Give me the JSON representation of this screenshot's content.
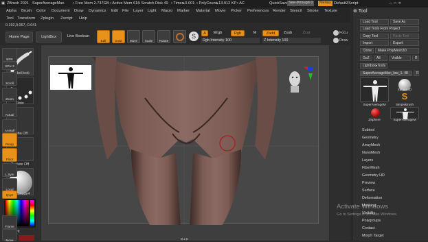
{
  "titlebar": {
    "app": "ZBrush 2021",
    "doc": "SuperAverageMan",
    "free_mem": "• Free Mem 2.737GB",
    "active_mem": "• Active Mem 616",
    "scratch": "• Scratch Disk 49",
    "timer": "• Timer▸0.001",
    "polycount": "• PolyCount▸13.912 KP",
    "ac": "• AC",
    "quicksave": "QuickSave",
    "seethrough": "See-through",
    "seethrough_val": "0",
    "menus": "Menus",
    "script": "DefaultZScript"
  },
  "menu_row1": [
    "Alpha",
    "Brush",
    "Color",
    "Document",
    "Draw",
    "Dynamics",
    "Edit",
    "File",
    "Layer",
    "Light",
    "Macro",
    "Marker",
    "Material",
    "Movie",
    "Picker",
    "Preferences",
    "Render",
    "Stencil",
    "Stroke",
    "Texture"
  ],
  "menu_row2": [
    "Tool",
    "Transform",
    "Zplugin",
    "Zscript",
    "Help"
  ],
  "coords": "0.192,0.067,-0.041",
  "top": {
    "home_page": "Home Page",
    "lightbox": "LightBox",
    "live_boolean": "Live Boolean",
    "edit": "Edit",
    "draw": "Draw",
    "move": "Move",
    "scale": "Scale",
    "rotate": "Rotate",
    "a_label": "A",
    "mrgb": "Mrgb",
    "rgb": "Rgb",
    "m": "M",
    "zadd": "Zadd",
    "zsub": "Zsub",
    "zcut": "Zcut",
    "rgb_intensity": "Rgb Intensity 100",
    "z_intensity": "Z Intensity 100",
    "focal": "Focu",
    "draw2": "Draw"
  },
  "left": {
    "snakehook": "SnakeHook",
    "dots": "Dots",
    "alpha_off": "Alpha Off",
    "texture_off": "Texture Off",
    "material": "SkinShade4",
    "gradient": "Gradient"
  },
  "right_strip": [
    "BPR",
    "SPix 3",
    "Scroll",
    "Zoom",
    "Actual",
    "AAHalf",
    "Persp",
    "Floor",
    "L.Sym",
    "Local",
    "Qxyz",
    "Frame",
    "Move"
  ],
  "tool_panel": {
    "title": "Tool",
    "load_tool": "Load Tool",
    "save_as": "Save As",
    "load_from_project": "Load Tools From Project",
    "copy_tool": "Copy Tool",
    "paste_tool": "Paste Tool",
    "import": "Import",
    "export": "Export",
    "clone": "Clone",
    "make_polymesh": "Make PolyMesh3D",
    "goz": "GoZ",
    "all": "All",
    "visible": "Visible",
    "r": "R",
    "lightbox_tools": "Lightbox▸Tools",
    "current_tool": "SuperAverageMan_low_1.",
    "current_num": "48",
    "r2": "R",
    "thumbs": [
      "SuperAverageM",
      "Sphere3D",
      "SimpleBrush",
      "ZSphere",
      "SuperAverageM"
    ],
    "subpalettes": [
      "Subtool",
      "Geometry",
      "ArrayMesh",
      "NanoMesh",
      "Layers",
      "FiberMesh",
      "Geometry HD",
      "Preview",
      "Surface",
      "Deformation",
      "Masking",
      "Visibility",
      "Polygroups",
      "Contact",
      "Morph Target"
    ]
  },
  "watermark": {
    "line1": "Activate Windows",
    "line2": "Go to Settings to activate Windows."
  },
  "colors": {
    "accent": "#e8921a",
    "skin": "#7a5a52"
  }
}
